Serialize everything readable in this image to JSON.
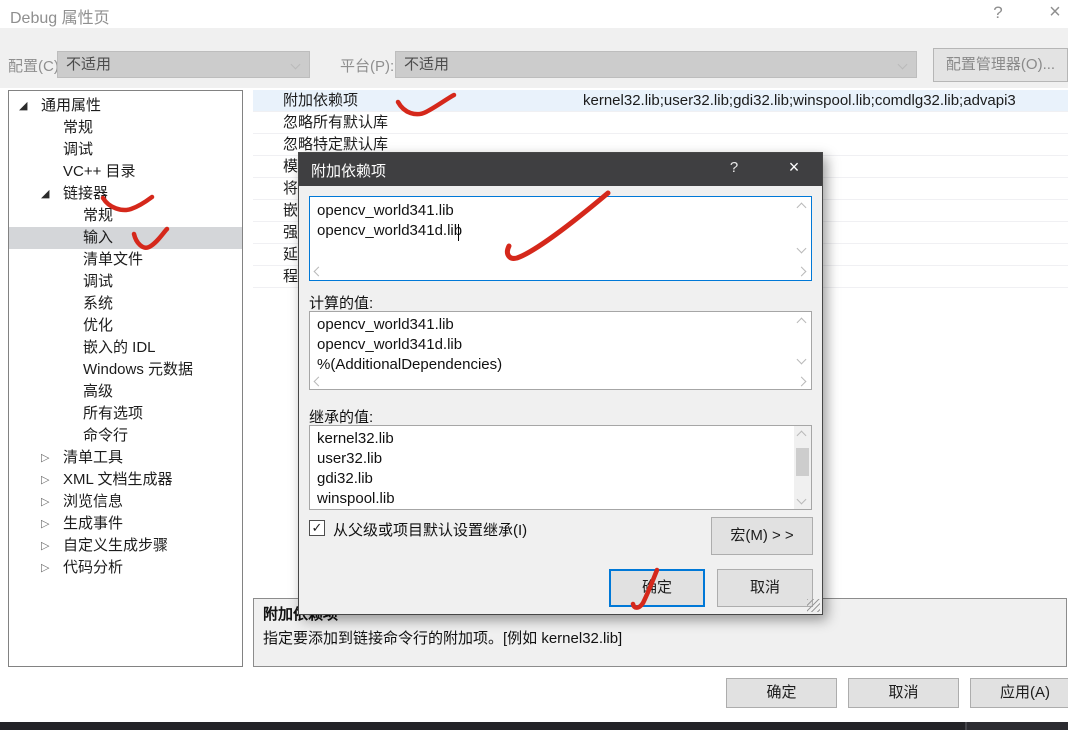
{
  "window": {
    "title": "Debug 属性页",
    "help": "?",
    "close": "×"
  },
  "toolbar": {
    "config_label": "配置(C):",
    "config_value": "不适用",
    "platform_label": "平台(P):",
    "platform_value": "不适用",
    "config_manager": "配置管理器(O)..."
  },
  "tree": {
    "items": [
      {
        "label": "通用属性",
        "level": 0,
        "state": "expanded",
        "selected": false
      },
      {
        "label": "常规",
        "level": 1
      },
      {
        "label": "调试",
        "level": 1
      },
      {
        "label": "VC++ 目录",
        "level": 1
      },
      {
        "label": "链接器",
        "level": 1,
        "state": "expanded"
      },
      {
        "label": "常规",
        "level": 2
      },
      {
        "label": "输入",
        "level": 2,
        "selected": true
      },
      {
        "label": "清单文件",
        "level": 2
      },
      {
        "label": "调试",
        "level": 2
      },
      {
        "label": "系统",
        "level": 2
      },
      {
        "label": "优化",
        "level": 2
      },
      {
        "label": "嵌入的 IDL",
        "level": 2
      },
      {
        "label": "Windows 元数据",
        "level": 2
      },
      {
        "label": "高级",
        "level": 2
      },
      {
        "label": "所有选项",
        "level": 2
      },
      {
        "label": "命令行",
        "level": 2
      },
      {
        "label": "清单工具",
        "level": 1,
        "state": "collapsed"
      },
      {
        "label": "XML 文档生成器",
        "level": 1,
        "state": "collapsed"
      },
      {
        "label": "浏览信息",
        "level": 1,
        "state": "collapsed"
      },
      {
        "label": "生成事件",
        "level": 1,
        "state": "collapsed"
      },
      {
        "label": "自定义生成步骤",
        "level": 1,
        "state": "collapsed"
      },
      {
        "label": "代码分析",
        "level": 1,
        "state": "collapsed"
      }
    ]
  },
  "grid": {
    "rows": [
      {
        "name": "附加依赖项",
        "value": "kernel32.lib;user32.lib;gdi32.lib;winspool.lib;comdlg32.lib;advapi3",
        "highlighted": true
      },
      {
        "name": "忽略所有默认库",
        "value": ""
      },
      {
        "name": "忽略特定默认库",
        "value": ""
      },
      {
        "name": "模块定义文件",
        "value": ""
      },
      {
        "name": "将模块添加到程序集",
        "value": ""
      },
      {
        "name": "嵌入托管资源文件",
        "value": ""
      },
      {
        "name": "强制符号引用",
        "value": ""
      },
      {
        "name": "延迟加载的 DLL",
        "value": ""
      },
      {
        "name": "程序集链接资源",
        "value": ""
      }
    ]
  },
  "modal": {
    "title": "附加依赖项",
    "help": "?",
    "close": "×",
    "edit_lines": [
      "opencv_world341.lib",
      "opencv_world341d.lib"
    ],
    "computed_label": "计算的值:",
    "computed_lines": [
      "opencv_world341.lib",
      "opencv_world341d.lib",
      "%(AdditionalDependencies)"
    ],
    "inherited_label": "继承的值:",
    "inherited_lines": [
      "kernel32.lib",
      "user32.lib",
      "gdi32.lib",
      "winspool.lib"
    ],
    "inherit_checkbox_label": "从父级或项目默认设置继承(I)",
    "inherit_checked": true,
    "check_glyph": "✓",
    "macros_button": "宏(M) > >",
    "ok": "确定",
    "cancel": "取消"
  },
  "description": {
    "title": "附加依赖项",
    "text": "指定要添加到链接命令行的附加项。[例如 kernel32.lib]"
  },
  "footer": {
    "ok": "确定",
    "cancel": "取消",
    "apply": "应用(A)"
  },
  "colors": {
    "accent_blue": "#0078d7",
    "annotation_red": "#d5281b",
    "modal_titlebar": "#3f3f41",
    "tree_selection": "#d4d6d9",
    "row_highlight": "#e9f2fb"
  }
}
